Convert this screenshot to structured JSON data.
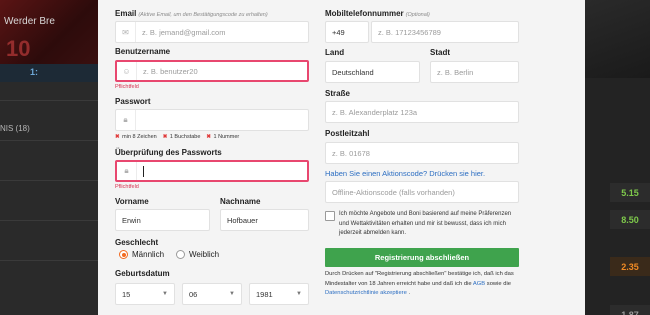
{
  "background": {
    "promo_text": "Werder Bre",
    "promo_number": "10",
    "tab_label": "1:",
    "list_label": "NIS (18)",
    "odds": [
      "5.15",
      "8.50",
      "2.35",
      "1.87"
    ]
  },
  "form": {
    "email": {
      "label": "Email",
      "hint": "(Aktive Email, um den Bestätigungscode zu erhalten)",
      "placeholder": "z. B. jemand@gmail.com"
    },
    "username": {
      "label": "Benutzername",
      "placeholder": "z. B. benutzer20",
      "error": "Pflichtfeld"
    },
    "password": {
      "label": "Passwort",
      "rules": [
        "min 8 Zeichen",
        "1 Buchstabe",
        "1 Nummer"
      ],
      "rule_mark": "✖"
    },
    "password_confirm": {
      "label": "Überprüfung des Passworts",
      "error": "Pflichtfeld"
    },
    "first_name": {
      "label": "Vorname",
      "value": "Erwin"
    },
    "last_name": {
      "label": "Nachname",
      "value": "Hofbauer"
    },
    "gender": {
      "label": "Geschlecht",
      "options": [
        "Männlich",
        "Weiblich"
      ],
      "selected": "Männlich"
    },
    "birthdate": {
      "label": "Geburtsdatum",
      "day": "15",
      "month": "06",
      "year": "1981"
    },
    "mobile": {
      "label": "Mobiltelefonnummer",
      "hint": "(Optional)",
      "prefix": "+49",
      "placeholder": "z. B. 17123456789"
    },
    "country": {
      "label": "Land",
      "value": "Deutschland"
    },
    "city": {
      "label": "Stadt",
      "placeholder": "z. B.  Berlin"
    },
    "street": {
      "label": "Straße",
      "placeholder": "z. B. Alexanderplatz 123a"
    },
    "postcode": {
      "label": "Postleitzahl",
      "placeholder": "z. B. 01678"
    },
    "promo_link": "Haben Sie einen Aktionscode? Drücken sie hier.",
    "promo_placeholder": "Offline-Aktionscode (falls vorhanden)",
    "consent_text": "Ich möchte Angebote und Boni basierend auf meine Präferenzen und Wettaktivitäten erhalten und mir ist bewusst, dass ich mich jederzeit abmelden kann.",
    "submit_label": "Registrierung abschließen",
    "fine_print": "Durch Drücken auf \"Registrierung abschließen\" bestätige ich, daß ich das Mindestalter von 18 Jahren erreicht habe und daß ich die",
    "agb_link": "AGB",
    "fine_mid": "sowie die",
    "privacy_link": "Datenschutzrichtlinie akzeptiere",
    "fine_end": "."
  },
  "colors": {
    "error": "#e8476f",
    "accent": "#f26a21",
    "submit": "#3fa34d",
    "link": "#2c6ec2"
  }
}
